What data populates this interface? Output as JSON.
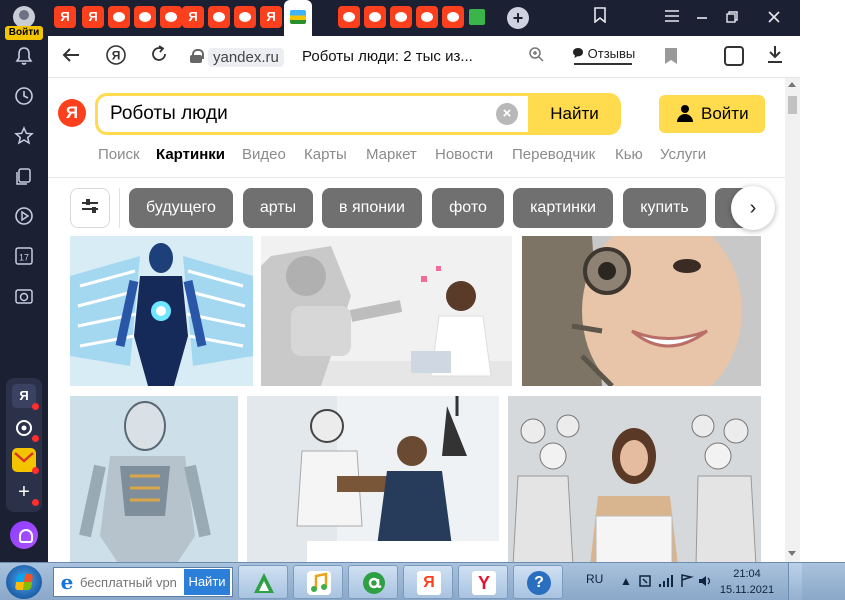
{
  "sidebar": {
    "login_label": "Войти",
    "apps": [
      "Я",
      "",
      "",
      "+"
    ]
  },
  "tabs": {
    "new_tab": "+",
    "ya_letter": "Я"
  },
  "addressbar": {
    "domain": "yandex.ru",
    "title": "Роботы люди: 2 тыс из...",
    "reviews_label": "Отзывы"
  },
  "search": {
    "logo": "Я",
    "query": "Роботы люди",
    "button": "Найти",
    "login": "Войти"
  },
  "services": [
    {
      "label": "Поиск",
      "active": false
    },
    {
      "label": "Картинки",
      "active": true
    },
    {
      "label": "Видео",
      "active": false
    },
    {
      "label": "Карты",
      "active": false
    },
    {
      "label": "Маркет",
      "active": false
    },
    {
      "label": "Новости",
      "active": false
    },
    {
      "label": "Переводчик",
      "active": false
    },
    {
      "label": "Кью",
      "active": false
    },
    {
      "label": "Услуги",
      "active": false
    }
  ],
  "chips": [
    "будущего",
    "арты",
    "в японии",
    "фото",
    "картинки",
    "купить"
  ],
  "images": [
    {
      "alt": "blue-cyborg-wings"
    },
    {
      "alt": "robot-and-woman-office"
    },
    {
      "alt": "cyborg-woman-face"
    },
    {
      "alt": "silver-humanoid-robot"
    },
    {
      "alt": "robot-and-man-office"
    },
    {
      "alt": "woman-among-robots"
    }
  ],
  "taskbar": {
    "search_placeholder": "бесплатный vpn",
    "search_button": "Найти",
    "lang": "RU",
    "time": "21:04",
    "date": "15.11.2021",
    "apps": [
      "",
      "",
      "",
      "Я",
      "Y",
      "?"
    ]
  },
  "colors": {
    "accent": "#ffdb4d",
    "yandex_red": "#fc3f1d",
    "sidebar_bg": "#1b2033",
    "chip_bg": "#707070"
  }
}
